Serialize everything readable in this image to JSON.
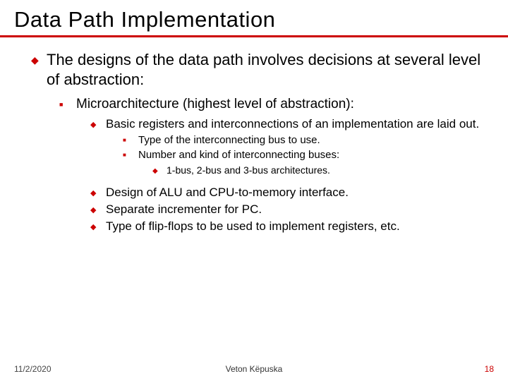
{
  "title": "Data Path Implementation",
  "l1": "The designs of the data path involves decisions at several level of abstraction:",
  "l2": "Microarchitecture (highest level of abstraction):",
  "l3a": "Basic registers and interconnections of an implementation are laid out.",
  "l4a": "Type of the interconnecting bus to use.",
  "l4b": "Number and kind of interconnecting buses:",
  "l5a": "1-bus, 2-bus and 3-bus architectures.",
  "l3b": "Design of ALU and CPU-to-memory interface.",
  "l3c": "Separate incrementer for PC.",
  "l3d": "Type of flip-flops to be used to implement registers, etc.",
  "footer": {
    "date": "11/2/2020",
    "author": "Veton Këpuska",
    "page": "18"
  }
}
